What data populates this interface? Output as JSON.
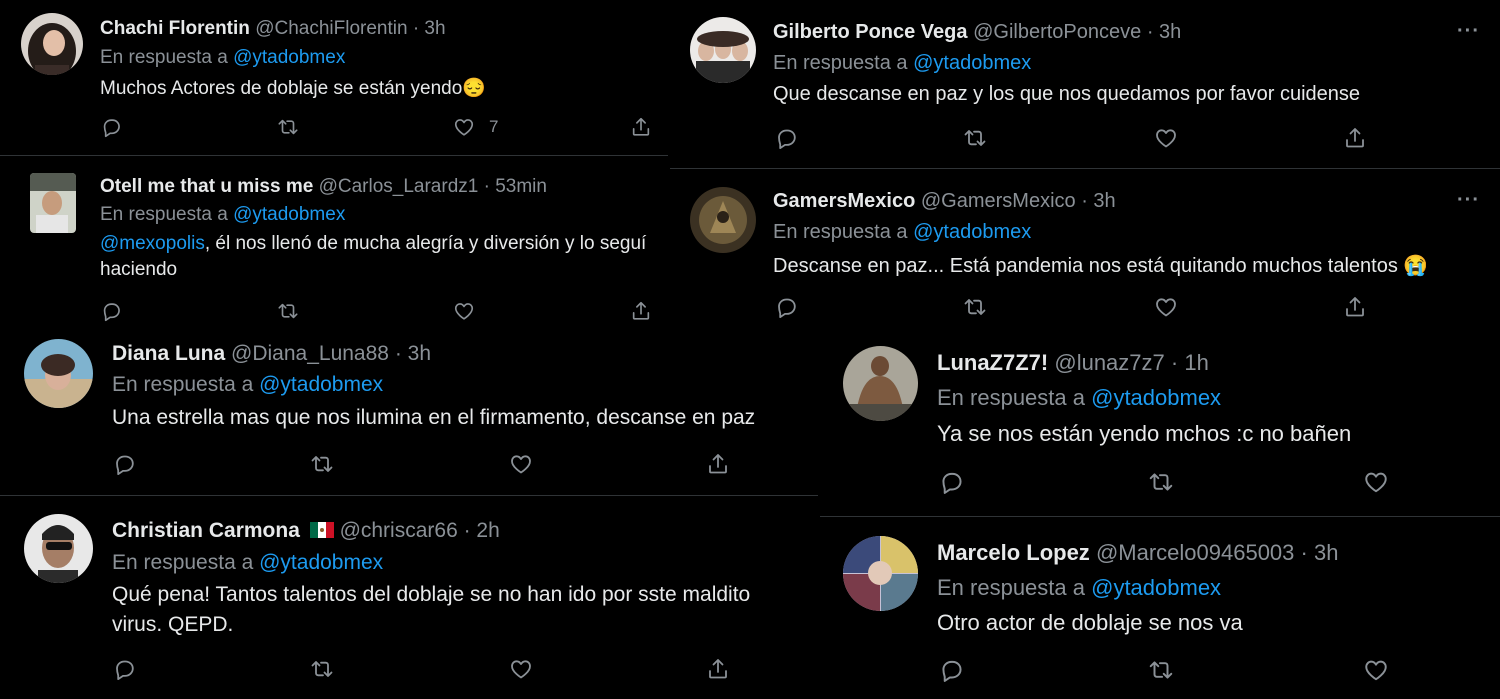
{
  "common": {
    "reply_prefix": "En respuesta a",
    "reply_to": "@ytadobmex",
    "more": "···"
  },
  "tweets": [
    {
      "name": "Chachi Florentin",
      "handle": "@ChachiFlorentin",
      "time": "· 3h",
      "text": "Muchos Actores de doblaje se están yendo😔",
      "likes": "7"
    },
    {
      "name": "Otell me that u miss me",
      "handle": "@Carlos_Larardz1",
      "time": "· 53min",
      "text_mention": "@mexopolis",
      "text": ", él nos llenó de mucha alegría y diversión y lo seguí",
      "text2": "haciendo"
    },
    {
      "name": "Diana Luna",
      "handle": "@Diana_Luna88",
      "time": "· 3h",
      "text": "Una estrella mas que nos ilumina en el firmamento, descanse en paz"
    },
    {
      "name": "Christian Carmona",
      "flag": "🇲🇽",
      "handle": "@chriscar66",
      "time": "· 2h",
      "text": "Qué pena! Tantos talentos del doblaje se no han ido por sste maldito",
      "text2": "virus. QEPD."
    },
    {
      "name": "Gilberto Ponce Vega",
      "handle": "@GilbertoPonceve",
      "time": "· 3h",
      "text": "Que descanse en paz y los que nos quedamos por favor cuidense"
    },
    {
      "name": "GamersMexico",
      "handle": "@GamersMexico",
      "time": "· 3h",
      "text": "Descanse en paz... Está pandemia nos está quitando muchos talentos 😭"
    },
    {
      "name": "LunaZ7Z7!",
      "handle": "@lunaz7z7",
      "time": "· 1h",
      "text": "Ya se nos están yendo mchos :c no bañen"
    },
    {
      "name": "Marcelo Lopez",
      "handle": "@Marcelo09465003",
      "time": "· 3h",
      "text": "Otro actor de doblaje se nos va"
    }
  ],
  "icons": {
    "reply": "reply-icon",
    "retweet": "retweet-icon",
    "like": "like-icon",
    "share": "share-icon",
    "more": "more-icon"
  }
}
